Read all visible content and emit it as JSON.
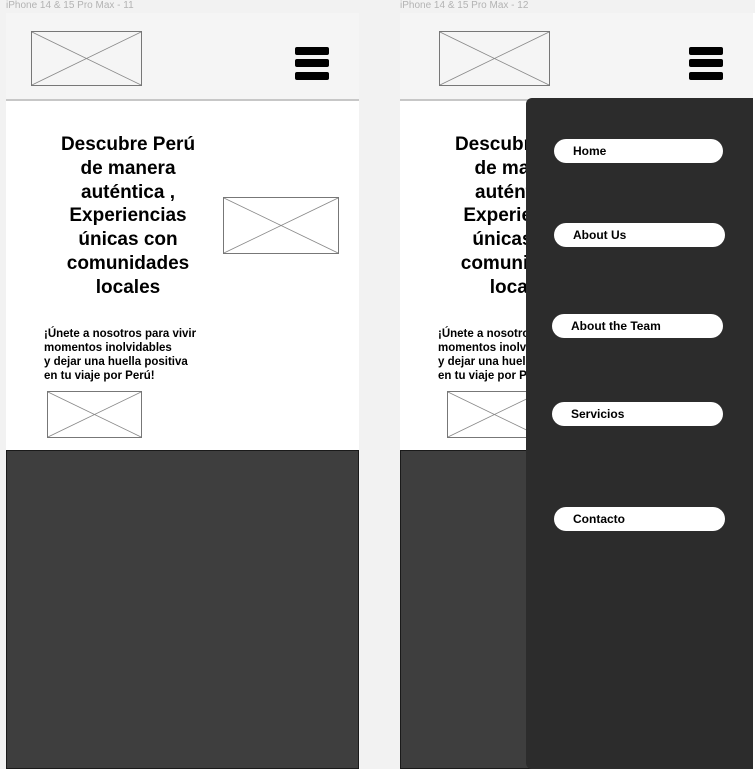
{
  "frames": [
    {
      "label": "iPhone 14 & 15 Pro Max - 11",
      "hero": {
        "title_lines": [
          "Descubre Perú",
          "de manera",
          "auténtica ,",
          "Experiencias",
          "únicas con",
          "comunidades",
          "locales"
        ],
        "subtitle_lines": [
          "¡Únete a nosotros para vivir",
          "momentos inolvidables",
          "y dejar una huella positiva",
          "en tu viaje por Perú!"
        ]
      }
    },
    {
      "label": "iPhone 14 & 15 Pro Max - 12",
      "hero": {
        "title_lines": [
          "Descubre Perú",
          "de manera",
          "auténtica ,",
          "Experiencias",
          "únicas con",
          "comunidades",
          "locales"
        ],
        "subtitle_lines": [
          "¡Únete a nosotros para vivir",
          "momentos inolvidables",
          "y dejar una huella positiva",
          "en tu viaje por Perú!"
        ]
      },
      "menu": {
        "items": [
          "Home",
          "About Us",
          "About the Team",
          "Servicios",
          "Contacto"
        ]
      }
    }
  ],
  "icons": {
    "menu": "hamburger-menu-icon",
    "image": "image-placeholder-icon"
  },
  "colors": {
    "header_bg": "#f5f5f5",
    "dark_block": "#3e3e3e",
    "menu_panel": "#2c2c2c",
    "menu_item": "#ffffff"
  }
}
